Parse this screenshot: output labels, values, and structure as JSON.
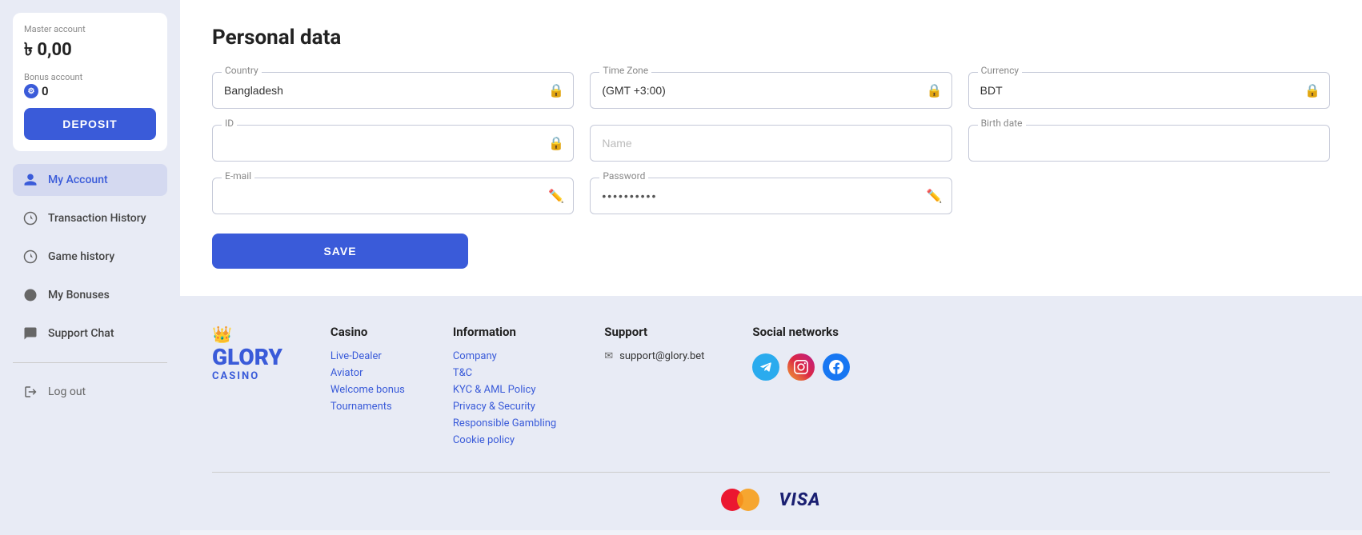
{
  "sidebar": {
    "master_label": "Master account",
    "master_balance": "৳ 0,00",
    "bonus_label": "Bonus account",
    "bonus_balance": "0",
    "deposit_button": "DEPOSIT",
    "nav_items": [
      {
        "id": "my-account",
        "label": "My Account",
        "active": true
      },
      {
        "id": "transaction-history",
        "label": "Transaction History",
        "active": false
      },
      {
        "id": "game-history",
        "label": "Game history",
        "active": false
      },
      {
        "id": "my-bonuses",
        "label": "My Bonuses",
        "active": false
      },
      {
        "id": "support-chat",
        "label": "Support Chat",
        "active": false
      }
    ],
    "logout_label": "Log out"
  },
  "main": {
    "page_title": "Personal data",
    "fields": {
      "country_label": "Country",
      "country_value": "Bangladesh",
      "timezone_label": "Time Zone",
      "timezone_value": "(GMT +3:00)",
      "currency_label": "Currency",
      "currency_value": "BDT",
      "id_label": "ID",
      "id_value": "",
      "name_label": "",
      "name_placeholder": "Name",
      "birthdate_label": "Birth date",
      "birthdate_value": "",
      "email_label": "E-mail",
      "email_value": "",
      "password_label": "Password",
      "password_value": "••••••••••"
    },
    "save_button": "SAVE"
  },
  "footer": {
    "logo_text": "GLORY",
    "logo_casino": "CASINO",
    "columns": [
      {
        "title": "Casino",
        "links": [
          "Live-Dealer",
          "Aviator",
          "Welcome bonus",
          "Tournaments"
        ]
      },
      {
        "title": "Information",
        "links": [
          "Company",
          "T&C",
          "KYC & AML Policy",
          "Privacy & Security",
          "Responsible Gambling",
          "Cookie policy"
        ]
      },
      {
        "title": "Support",
        "email": "support@glory.bet"
      },
      {
        "title": "Social networks"
      }
    ],
    "payment_methods": [
      "Mastercard",
      "VISA"
    ]
  }
}
